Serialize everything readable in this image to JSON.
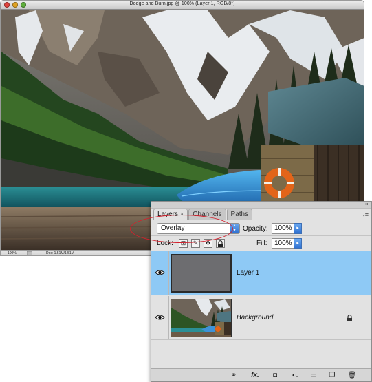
{
  "document": {
    "title": "Dodge and Burn.jpg @ 100% (Layer 1, RGB/8*)",
    "status_zoom": "100%",
    "status_doc": "Doc: 1.51M/1.51M"
  },
  "layers_panel": {
    "tabs": [
      {
        "label": "Layers",
        "active": true,
        "close_glyph": "×"
      },
      {
        "label": "Channels",
        "active": false
      },
      {
        "label": "Paths",
        "active": false
      }
    ],
    "menu_icon": "panel-menu-icon",
    "blend_mode": "Overlay",
    "opacity_label": "Opacity:",
    "opacity_value": "100%",
    "lock_label": "Lock:",
    "fill_label": "Fill:",
    "fill_value": "100%",
    "layers": [
      {
        "name": "Layer 1",
        "selected": true,
        "visible": true,
        "locked": false
      },
      {
        "name": "Background",
        "selected": false,
        "visible": true,
        "locked": true
      }
    ],
    "footer_buttons": [
      {
        "icon": "link-layers-icon",
        "glyph": "⚭"
      },
      {
        "icon": "layer-style-icon",
        "glyph": "fx."
      },
      {
        "icon": "layer-mask-icon",
        "glyph": "◘"
      },
      {
        "icon": "adjustment-layer-icon",
        "glyph": "◐."
      },
      {
        "icon": "new-group-icon",
        "glyph": "▭"
      },
      {
        "icon": "new-layer-icon",
        "glyph": "❐"
      },
      {
        "icon": "delete-layer-icon",
        "glyph": "🗑"
      }
    ]
  },
  "colors": {
    "selection_blue": "#8ec9f5",
    "annotation_red": "#d2212d",
    "layer1_fill": "#6d6d70"
  }
}
